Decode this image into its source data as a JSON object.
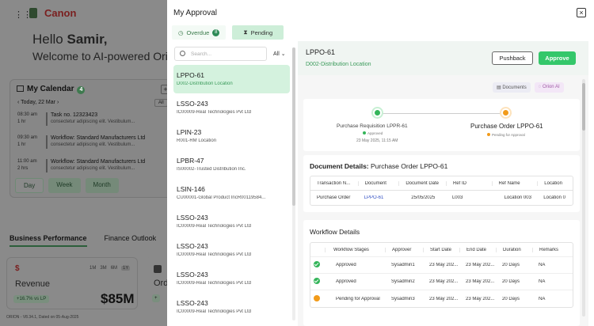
{
  "background": {
    "brand": "Canon",
    "hello": "Hello",
    "user": "Samir,",
    "welcome": "Welcome to AI-powered Ori",
    "calendar": {
      "title": "My Calendar",
      "count": "4",
      "today": "Today, 22 Mar",
      "filter": "All",
      "events": [
        {
          "time": "08:30 am",
          "dur": "1 hr",
          "name": "Task no. 12323423",
          "sub": "consectetur adipiscing elit. Vestibulum..."
        },
        {
          "time": "09:30 am",
          "dur": "1 hr",
          "name": "Workflow: Standard Manufacturers Ltd",
          "sub": "consectetur adipiscing elit. Vestibulum..."
        },
        {
          "time": "11:00 am",
          "dur": "2 hrs",
          "name": "Workflow: Standard Manufacturers Ltd",
          "sub": "consectetur adipiscing elit. Vestibulum..."
        }
      ],
      "views": [
        "Day",
        "Week",
        "Month"
      ]
    },
    "tabs": [
      "Business Performance",
      "Finance Outlook"
    ],
    "revenue": {
      "label": "Revenue",
      "periods": [
        "1M",
        "3M",
        "6M",
        "1Y"
      ],
      "active_period": "1Y",
      "change": "+16.7% vs LP",
      "amount": "$85M"
    },
    "orders": {
      "label": "Ord",
      "change": "+"
    },
    "footer": "ORION - V8.34.1, Dated on 05-Aug-2025"
  },
  "modal": {
    "title": "My Approval",
    "close": "×",
    "tabs": {
      "overdue": "Overdue",
      "overdue_count": "8",
      "pending": "Pending"
    },
    "search_placeholder": "Search...",
    "filter": "All",
    "items": [
      {
        "id": "LPPO-61",
        "desc": "D002-Distribution Location"
      },
      {
        "id": "LSSO-243",
        "desc": "IC00009-Real Technologies Pvt Ltd"
      },
      {
        "id": "LPIN-23",
        "desc": "R001-RM Location"
      },
      {
        "id": "LPBR-47",
        "desc": "IS00002-Trusted Distribution Inc."
      },
      {
        "id": "LSIN-146",
        "desc": "CU00001-Global Product IncR00119584..."
      },
      {
        "id": "LSSO-243",
        "desc": "IC00009-Real Technologies Pvt Ltd"
      },
      {
        "id": "LSSO-243",
        "desc": "IC00009-Real Technologies Pvt Ltd"
      },
      {
        "id": "LSSO-243",
        "desc": "IC00009-Real Technologies Pvt Ltd"
      },
      {
        "id": "LSSO-243",
        "desc": "IC00009-Real Technologies Pvt Ltd"
      }
    ],
    "detail": {
      "id": "LPPO-61",
      "location": "D002-Distribution Location",
      "pushback": "Pushback",
      "approve": "Approve",
      "chips": [
        "Documents",
        "Orion AI"
      ],
      "flow": [
        {
          "label": "Purchase Requisition LPPR-61",
          "status": "Approved",
          "date": "23 May 2025, 11:15 AM",
          "color": "#34b55a"
        },
        {
          "label": "Purchase Order LPPO-61",
          "status": "Pending for Approval",
          "color": "#f29b1a"
        }
      ],
      "doc_title": "Document Details:",
      "doc_sub": "Purchase Order LPPO-61",
      "doc_headers": [
        "Transaction N...",
        "Document",
        "Document Date",
        "Ref ID",
        "Ref Name",
        "Location"
      ],
      "doc_row": [
        "Purchase Order",
        "LPPO-61",
        "25/05/2025",
        "L003",
        "Location 003",
        "Location 0"
      ],
      "wf_title": "Workflow Details",
      "wf_headers": [
        "",
        "Workflow Stages",
        "Approver",
        "Start Date",
        "End Date",
        "Duration",
        "Remarks"
      ],
      "wf_rows": [
        {
          "stage": "Approved",
          "approver": "Sysadmin1",
          "start": "23 May 202...",
          "end": "23 May 202...",
          "dur": "20 Days",
          "rem": "NA",
          "st": "ok"
        },
        {
          "stage": "Approved",
          "approver": "Sysadmin2",
          "start": "23 May 202...",
          "end": "23 May 202...",
          "dur": "20 Days",
          "rem": "NA",
          "st": "ok"
        },
        {
          "stage": "Pending for Approval",
          "approver": "Sysadmin3",
          "start": "23 May 202...",
          "end": "23 May 202...",
          "dur": "20 Days",
          "rem": "NA",
          "st": "pe"
        }
      ]
    }
  }
}
